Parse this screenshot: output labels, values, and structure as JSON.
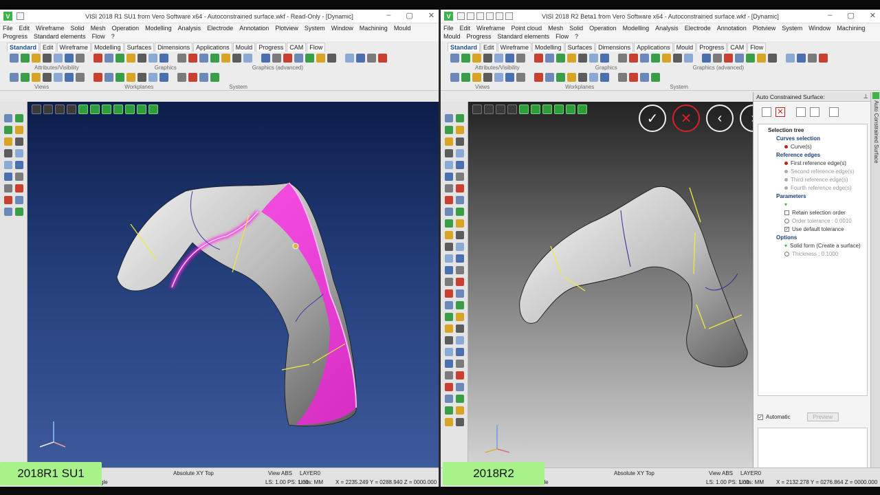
{
  "left": {
    "title": "VISI 2018 R1 SU1 from Vero Software x64 - Autoconstrained surface.wkf - Read-Only - [Dynamic]",
    "menu": [
      "File",
      "Edit",
      "Wireframe",
      "Solid",
      "Mesh",
      "Operation",
      "Modelling",
      "Analysis",
      "Electrode",
      "Annotation",
      "Plotview",
      "System",
      "Window",
      "Machining",
      "Mould",
      "Progress",
      "Standard elements",
      "Flow",
      "?"
    ],
    "tabs": [
      "Standard",
      "Edit",
      "Wireframe",
      "Modelling",
      "Surfaces",
      "Dimensions",
      "Applications",
      "Mould",
      "Progress",
      "CAM",
      "Flow"
    ],
    "group_labels": [
      "Attributes/Visibility",
      "Graphics",
      "Graphics (advanced)",
      "Views",
      "Workplanes",
      "System"
    ],
    "status": {
      "view_mode": "Absolute XY Top",
      "view_abs": "View ABS",
      "layer": "LAYER0",
      "ls": "LS: 1.00 PS: 1.00",
      "units": "Units: MM",
      "coords": "X = 2235.249 Y = 0288.940 Z = 0000.000",
      "fragment": "gle"
    },
    "version": "2018R1 SU1"
  },
  "right": {
    "title": "VISI 2018 R2 Beta1 from Vero Software x64 - Autoconstrained surface.wkf - [Dynamic]",
    "menu": [
      "File",
      "Edit",
      "Wireframe",
      "Point cloud",
      "Mesh",
      "Solid",
      "Operation",
      "Modelling",
      "Analysis",
      "Electrode",
      "Annotation",
      "Plotview",
      "System",
      "Window",
      "Machining",
      "Mould",
      "Progress",
      "Standard elements",
      "Flow",
      "?"
    ],
    "tabs": [
      "Standard",
      "Edit",
      "Wireframe",
      "Modelling",
      "Surfaces",
      "Dimensions",
      "Applications",
      "Mould",
      "Progress",
      "CAM",
      "Flow"
    ],
    "group_labels": [
      "Attributes/Visibility",
      "Graphics",
      "Graphics (advanced)",
      "Views",
      "Workplanes",
      "System"
    ],
    "panel": {
      "title": "Auto Constrained Surface:",
      "vertical_tab": "Auto Constrained Surface",
      "tree": {
        "root": "Selection tree",
        "curves_section": "Curves selection",
        "curves_item": "Curve(s)",
        "ref_section": "Reference edges",
        "ref_items": [
          "First reference edge(s)",
          "Second reference edge(s)",
          "Third reference edge(s)",
          "Fourth reference edge(s)"
        ],
        "params_section": "Parameters",
        "params_items": [
          "Retain selection order",
          "Order tolerance : 0.0010",
          "Use default tolerance"
        ],
        "options_section": "Options",
        "options_items": [
          "Solid form (Create a surface)",
          "Thickness : 0.1000"
        ]
      },
      "automatic_label": "Automatic",
      "preview_label": "Preview"
    },
    "status": {
      "view_mode": "Absolute XY Top",
      "view_abs": "View ABS",
      "layer": "LAYER0",
      "ls": "LS: 1.00 PS: 1.00",
      "units": "Units: MM",
      "coords": "X = 2132.278 Y = 0276.864 Z = 0000.000",
      "fragment": "gle"
    },
    "version": "2018R2"
  },
  "colors": {
    "accent_green": "#3bb54a",
    "badge_green": "#a8f28a",
    "highlight_magenta": "#ff1ee6",
    "edge_yellow": "#f2ea3a",
    "cancel_red": "#d6202a"
  },
  "icons": {
    "axis": "axis-triad-icon",
    "ok": "check-icon",
    "cancel": "close-icon",
    "prev": "chevron-left-icon",
    "next": "chevron-right-icon"
  }
}
